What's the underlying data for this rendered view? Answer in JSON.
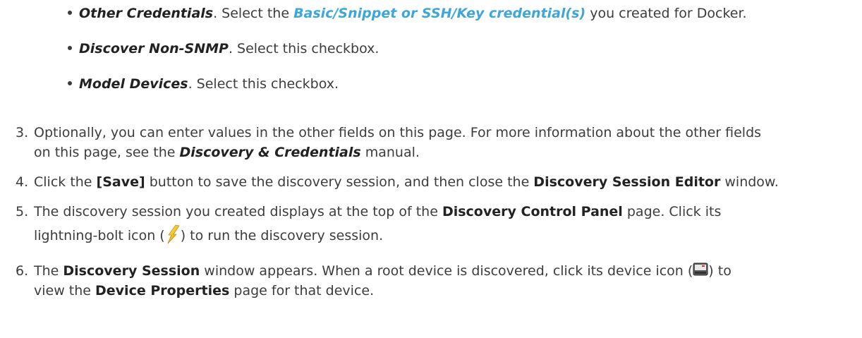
{
  "bullets": [
    {
      "term": "Other Credentials",
      "text_before": ". Select the ",
      "link": "Basic/Snippet or SSH/Key credential(s)",
      "text_after": " you created for Docker."
    },
    {
      "term": "Discover Non-SNMP",
      "text_after": ". Select this checkbox."
    },
    {
      "term": "Model Devices",
      "text_after": ". Select this checkbox."
    }
  ],
  "steps": [
    {
      "number": "3.",
      "line1": "Optionally, you can enter values in the other fields on this page. For more information about the other fields",
      "line2_before": "on this page, see the ",
      "manual": "Discovery & Credentials",
      "line2_after": " manual."
    },
    {
      "number": "4.",
      "t1": "Click the ",
      "b1": "[Save]",
      "t2": " button to save the discovery session, and then close the ",
      "b2": "Discovery Session Editor",
      "t3": " window."
    },
    {
      "number": "5.",
      "t1": "The discovery session you created displays at the top of the ",
      "b1": "Discovery Control Panel",
      "t2": " page. Click its",
      "t3": "lightning-bolt icon (",
      "t4": ") to run the discovery session."
    },
    {
      "number": "6.",
      "t1": "The ",
      "b1": "Discovery Session",
      "t2": " window appears. When a root device is discovered, click its device icon (",
      "t3": ") to",
      "t4": "view the ",
      "b2": "Device Properties",
      "t5": " page for that device."
    }
  ],
  "icons": {
    "bolt": "lightning-bolt-icon",
    "device": "device-icon"
  },
  "colors": {
    "link": "#3ea6d9",
    "text": "#3c3c3c"
  }
}
